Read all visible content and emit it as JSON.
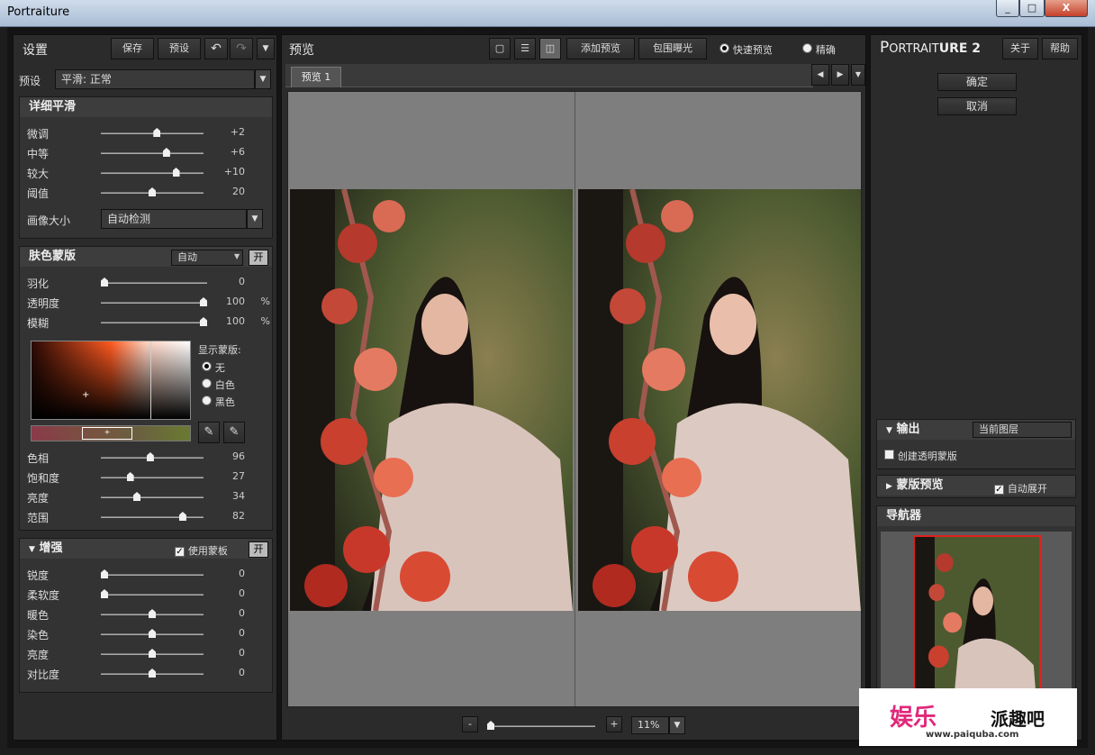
{
  "window": {
    "title": "Portraiture",
    "min": "_",
    "max": "□",
    "close": "X"
  },
  "left": {
    "title": "设置",
    "save": "保存",
    "preset_btn": "预设",
    "undo": "↶",
    "redo": "↷",
    "menu": "▼",
    "preset_label": "预设",
    "preset_value": "平滑: 正常",
    "detail": {
      "title": "详细平滑",
      "rows": [
        {
          "label": "微调",
          "value": "+2",
          "pos": 0.55
        },
        {
          "label": "中等",
          "value": "+6",
          "pos": 0.65
        },
        {
          "label": "较大",
          "value": "+10",
          "pos": 0.75
        },
        {
          "label": "阈值",
          "value": "20",
          "pos": 0.5
        }
      ],
      "size_label": "画像大小",
      "size_value": "自动检测"
    },
    "skin": {
      "title": "肤色蒙版",
      "mode": "自动",
      "toggle": "开",
      "rows": [
        {
          "label": "羽化",
          "value": "0",
          "unit": "",
          "pos": 0.0
        },
        {
          "label": "透明度",
          "value": "100",
          "unit": "%",
          "pos": 1.0
        },
        {
          "label": "模糊",
          "value": "100",
          "unit": "%",
          "pos": 1.0
        }
      ],
      "show_mask": "显示蒙版:",
      "opt_none": "无",
      "opt_white": "白色",
      "opt_black": "黑色",
      "rows2": [
        {
          "label": "色相",
          "value": "96",
          "pos": 0.48
        },
        {
          "label": "饱和度",
          "value": "27",
          "pos": 0.27
        },
        {
          "label": "亮度",
          "value": "34",
          "pos": 0.34
        },
        {
          "label": "范围",
          "value": "82",
          "pos": 0.82
        }
      ]
    },
    "enhance": {
      "title": "增强",
      "use_mask": "使用蒙板",
      "toggle": "开",
      "rows": [
        {
          "label": "锐度",
          "value": "0",
          "pos": 0.0
        },
        {
          "label": "柔软度",
          "value": "0",
          "pos": 0.0
        },
        {
          "label": "暖色",
          "value": "0",
          "pos": 0.5
        },
        {
          "label": "染色",
          "value": "0",
          "pos": 0.5
        },
        {
          "label": "亮度",
          "value": "0",
          "pos": 0.5
        },
        {
          "label": "对比度",
          "value": "0",
          "pos": 0.5
        }
      ]
    }
  },
  "center": {
    "title": "预览",
    "add": "添加预览",
    "clip": "包围曝光",
    "fast": "快速预览",
    "precise": "精确",
    "tab": "预览 1",
    "zoom": "11%",
    "minus": "-",
    "plus": "+"
  },
  "right": {
    "brand_a": "P",
    "brand_b": "ORTRAIT",
    "brand_c": "URE 2",
    "about": "关于",
    "help": "帮助",
    "ok": "确定",
    "cancel": "取消",
    "output": {
      "title": "输出",
      "layer": "当前图层",
      "transparent": "创建透明蒙版"
    },
    "mask_preview": {
      "title": "蒙版预览",
      "auto": "自动展开"
    },
    "navigator": {
      "title": "导航器"
    }
  },
  "watermark": {
    "a": "娱乐",
    "b": "派趣吧",
    "url": "www.paiquba.com"
  }
}
